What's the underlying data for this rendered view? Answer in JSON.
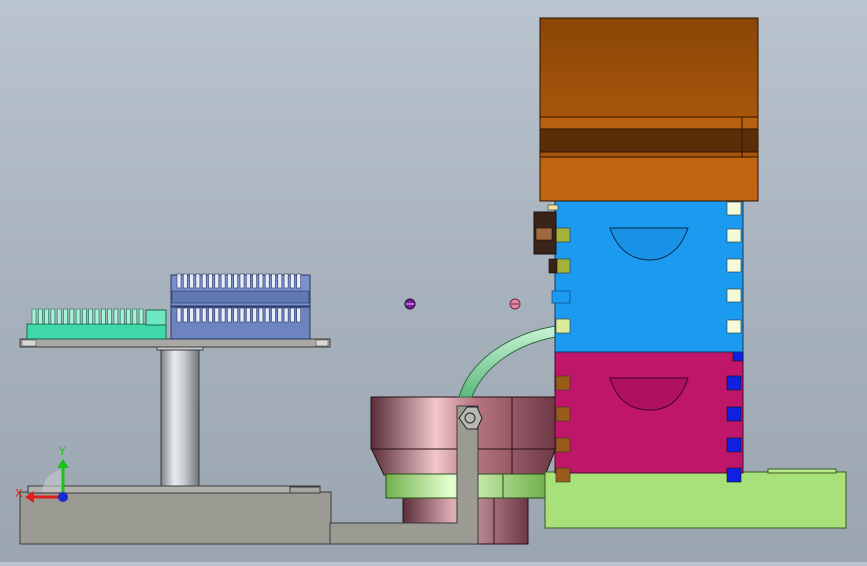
{
  "viewport": {
    "background_top": "#b9c4cf",
    "background_bottom": "#9aa5b0"
  },
  "triad": {
    "x_label": "X",
    "y_label": "Y",
    "x_color": "#e02020",
    "y_color": "#19c419",
    "z_color": "#1a2ad0"
  },
  "colors": {
    "base_gray": "#9b9a93",
    "shaft_gray": "#b8bcc2",
    "platform_gray": "#a8a8a4",
    "mint": "#3fd8a8",
    "slate_blue": "#6d84c0",
    "copper": "#c0640f",
    "copper_dark": "#5c2e08",
    "cyan_blue": "#1b9bf0",
    "magenta": "#c0166a",
    "lime": "#a8e07a",
    "bowl": "#8a4b58",
    "tube": "#8fe0a8"
  }
}
